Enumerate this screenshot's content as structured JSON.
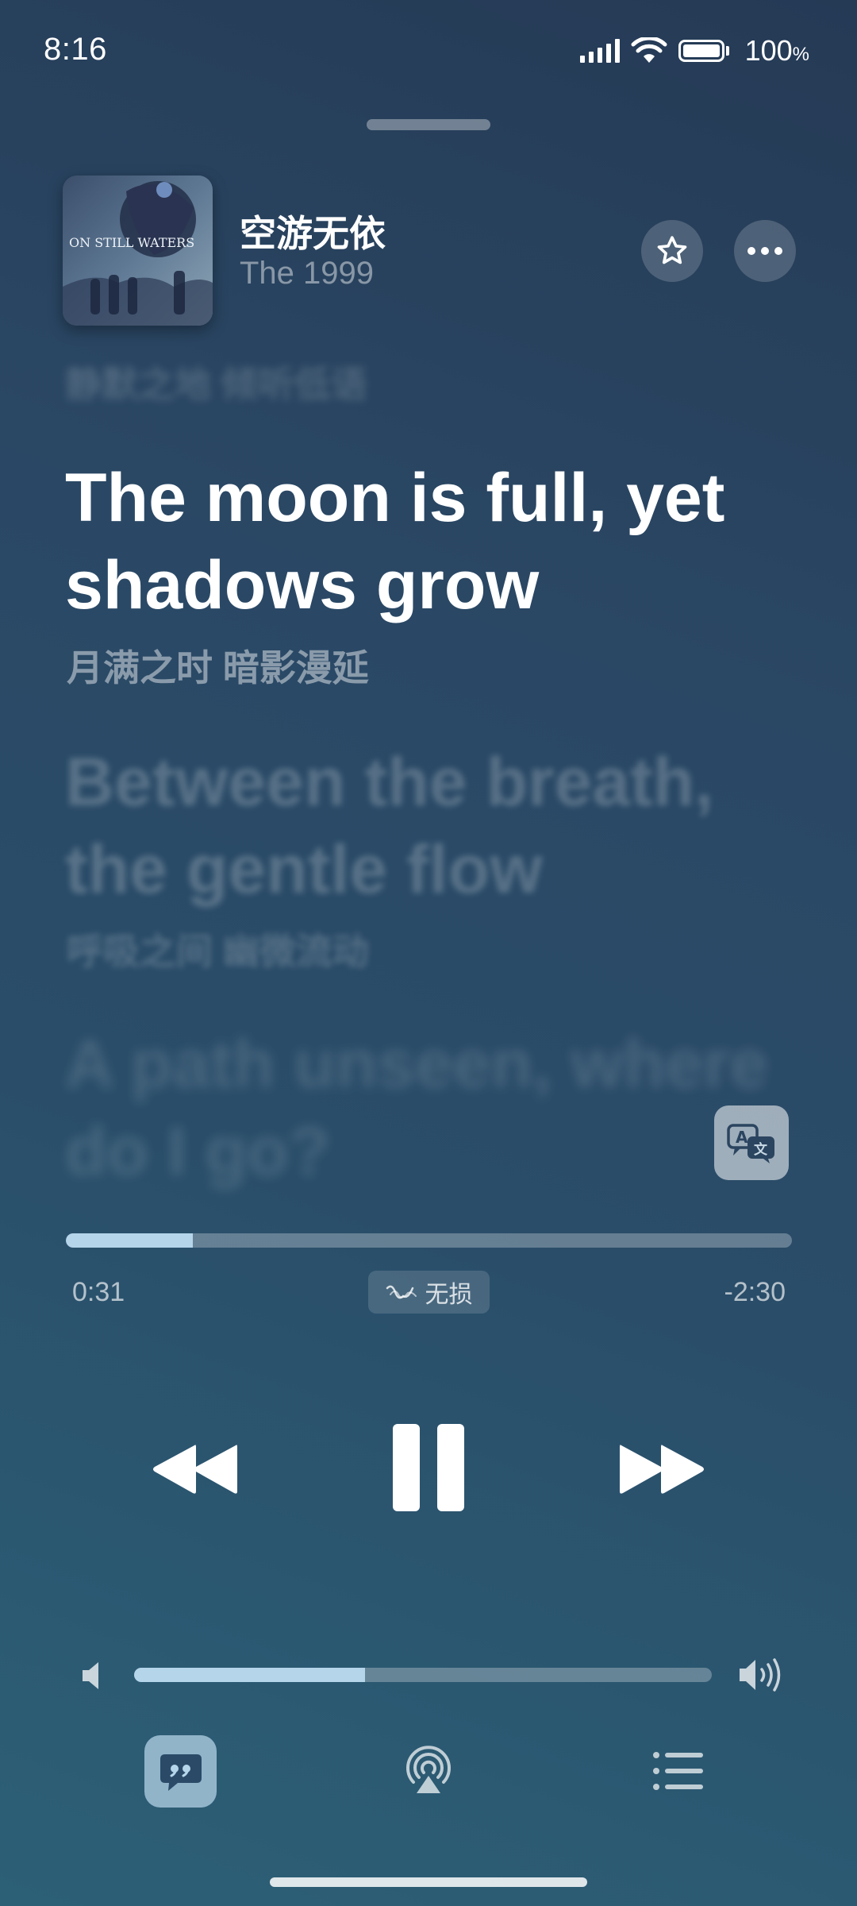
{
  "status_bar": {
    "time": "8:16",
    "battery_value": "100",
    "battery_unit": "%",
    "icons": [
      "signal-icon",
      "wifi-icon",
      "battery-icon"
    ]
  },
  "now_playing": {
    "title": "空游无依",
    "artist": "The 1999",
    "album_art_text": "ON STILL WATERS"
  },
  "header_actions": {
    "favorite_icon": "star-icon",
    "more_icon": "more-icon"
  },
  "lyrics": {
    "previous_blurred": "静默之地 倾听低语",
    "current": "The moon is full, yet shadows grow",
    "current_translation": "月满之时 暗影漫延",
    "next": "Between the breath, the gentle flow",
    "next_translation": "呼吸之间 幽微流动",
    "next2": "A path unseen, where do I go?"
  },
  "playback": {
    "elapsed": "0:31",
    "remaining": "-2:30",
    "progress_fraction": 0.175,
    "quality_label": "无损"
  },
  "volume": {
    "level_fraction": 0.4
  },
  "colors": {
    "accent": "#b5d5ea",
    "background_top": "#253a55",
    "background_bottom": "#2c6077"
  }
}
